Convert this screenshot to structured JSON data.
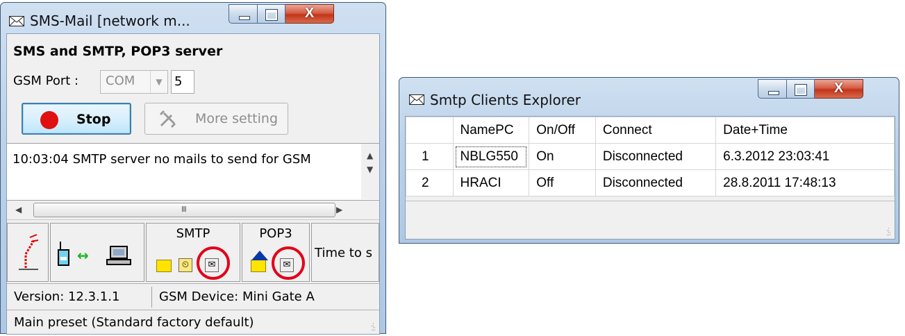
{
  "sms_window": {
    "title": "SMS-Mail  [network m...",
    "close_glyph": "X",
    "heading": "SMS and SMTP, POP3 server",
    "gsm_port_label": "GSM Port :",
    "port_type": "COM",
    "port_number": "5",
    "stop_label": "Stop",
    "more_setting_label": "More setting",
    "log_text": "10:03:04  SMTP server no mails to send for GSM",
    "scroll_grip": "III",
    "panels": {
      "smtp_title": "SMTP",
      "pop3_title": "POP3",
      "time_text": "Time to s"
    },
    "status": {
      "version": "Version: 12.3.1.1",
      "device": "GSM Device: Mini Gate A",
      "preset": "Main preset (Standard factory default)"
    },
    "icons": [
      "envelope-icon",
      "antenna-icon",
      "phone-icon",
      "link-arrows-icon",
      "computer-icon",
      "folder-icon",
      "clock-icon",
      "mail-stamp-icon",
      "red-circle-highlight"
    ]
  },
  "smtp_clients": {
    "title": "Smtp Clients Explorer",
    "close_glyph": "X",
    "columns": [
      "NamePC",
      "On/Off",
      "Connect",
      "Date+Time"
    ],
    "rows": [
      {
        "index": "1",
        "name": "NBLG550",
        "state": "On",
        "connect": "Disconnected",
        "datetime": "6.3.2012 23:03:41"
      },
      {
        "index": "2",
        "name": "HRACI",
        "state": "Off",
        "connect": "Disconnected",
        "datetime": "28.8.2011 17:48:13"
      }
    ]
  },
  "colors": {
    "accent_red": "#e01010",
    "highlight_ring": "#e2001a",
    "titlebar": "#bcd2ea"
  }
}
